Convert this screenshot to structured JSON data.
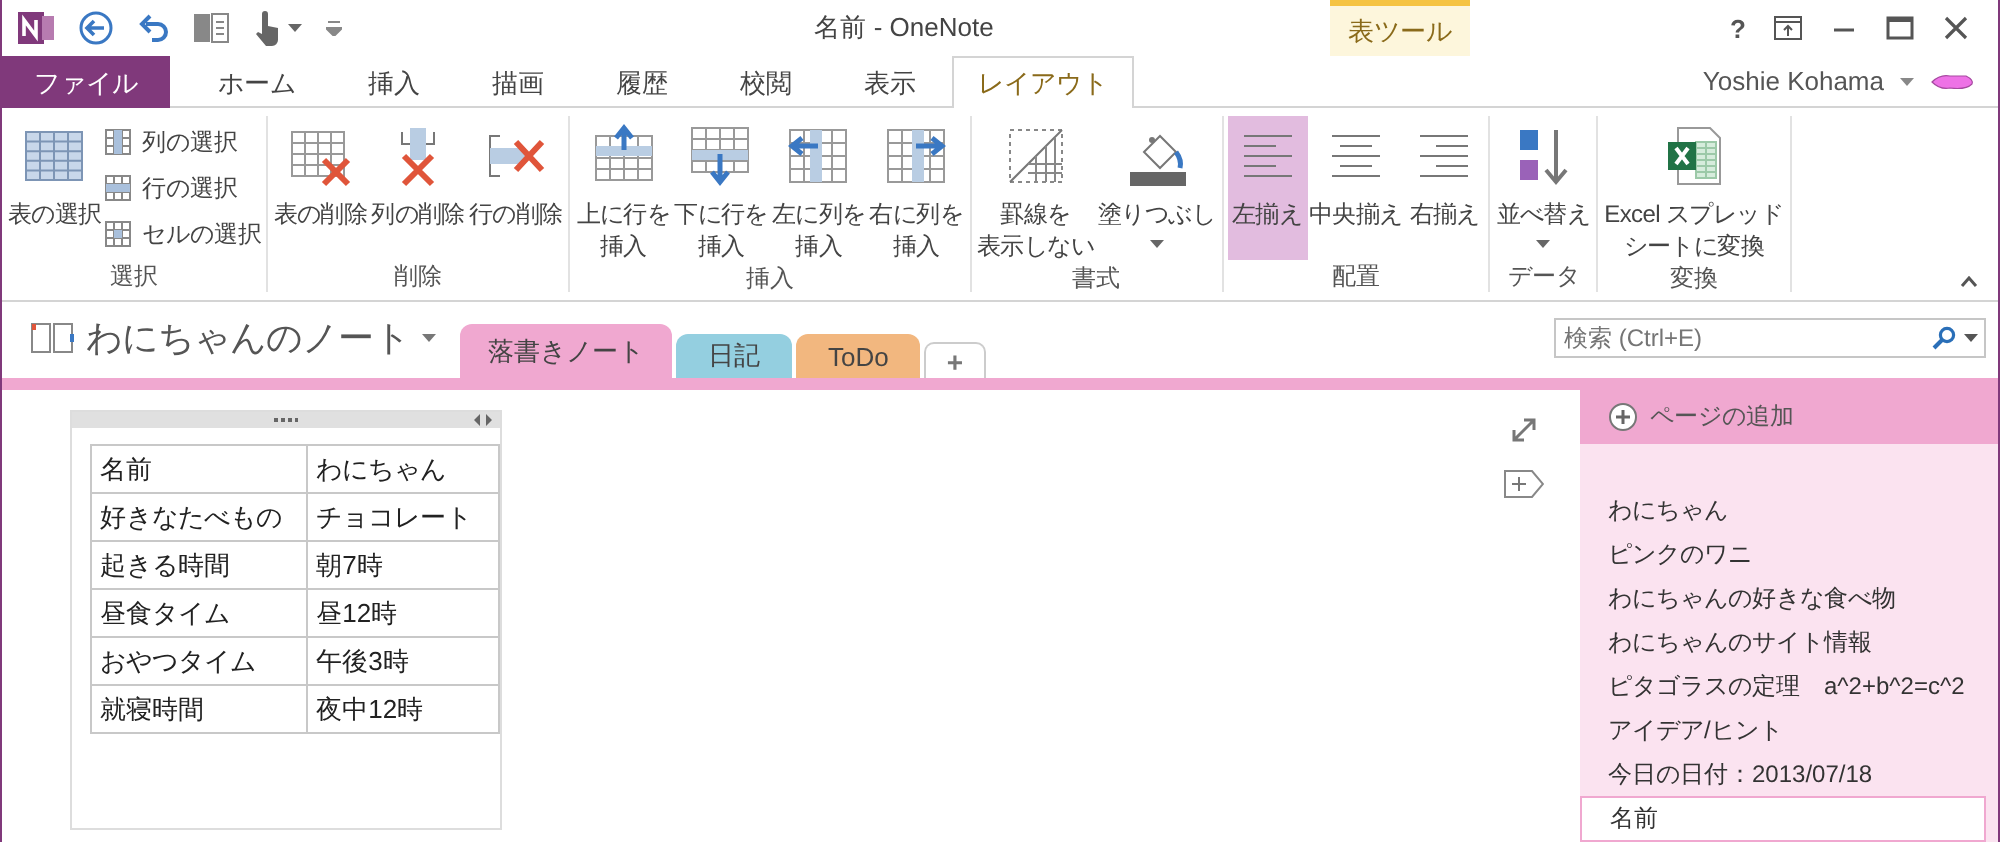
{
  "window": {
    "title": "名前 - OneNote",
    "context_tab": "表ツール",
    "help": "?"
  },
  "ribbon_tabs": [
    {
      "label": "ファイル",
      "kind": "file",
      "selected": false
    },
    {
      "label": "ホーム",
      "kind": "normal",
      "selected": false
    },
    {
      "label": "挿入",
      "kind": "normal",
      "selected": false
    },
    {
      "label": "描画",
      "kind": "normal",
      "selected": false
    },
    {
      "label": "履歴",
      "kind": "normal",
      "selected": false
    },
    {
      "label": "校閲",
      "kind": "normal",
      "selected": false
    },
    {
      "label": "表示",
      "kind": "normal",
      "selected": false
    },
    {
      "label": "レイアウト",
      "kind": "context",
      "selected": true
    }
  ],
  "user": "Yoshie Kohama",
  "ribbon_groups": [
    {
      "label": "選択",
      "commands": [
        {
          "kind": "large",
          "label": "表の選択",
          "dropdown": false
        },
        {
          "kind": "small",
          "label": "列の選択"
        },
        {
          "kind": "small",
          "label": "行の選択"
        },
        {
          "kind": "small",
          "label": "セルの選択"
        }
      ]
    },
    {
      "label": "削除",
      "commands": [
        {
          "kind": "large",
          "label": "表の削除",
          "dropdown": false
        },
        {
          "kind": "large",
          "label": "列の削除",
          "dropdown": false
        },
        {
          "kind": "large",
          "label": "行の削除",
          "dropdown": false
        }
      ]
    },
    {
      "label": "挿入",
      "commands": [
        {
          "kind": "large",
          "label": "上に行を挿入",
          "dropdown": false
        },
        {
          "kind": "large",
          "label": "下に行を挿入",
          "dropdown": false
        },
        {
          "kind": "large",
          "label": "左に列を挿入",
          "dropdown": false
        },
        {
          "kind": "large",
          "label": "右に列を挿入",
          "dropdown": false
        }
      ]
    },
    {
      "label": "書式",
      "commands": [
        {
          "kind": "large",
          "label": "罫線を表示しない",
          "dropdown": false
        },
        {
          "kind": "large",
          "label": "塗りつぶし",
          "dropdown": true
        }
      ]
    },
    {
      "label": "配置",
      "commands": [
        {
          "kind": "large",
          "label": "左揃え",
          "dropdown": false,
          "selected": true
        },
        {
          "kind": "large",
          "label": "中央揃え",
          "dropdown": false,
          "selected": false
        },
        {
          "kind": "large",
          "label": "右揃え",
          "dropdown": false,
          "selected": false
        }
      ]
    },
    {
      "label": "データ",
      "commands": [
        {
          "kind": "large",
          "label": "並べ替え",
          "dropdown": true
        }
      ]
    },
    {
      "label": "変換",
      "commands": [
        {
          "kind": "large",
          "label": "Excel スプレッドシートに変換",
          "dropdown": false
        }
      ]
    }
  ],
  "notebook": {
    "name": "わにちゃんのノート"
  },
  "sections": [
    {
      "label": "落書きノート",
      "color": "#f0a8d0",
      "selected": true
    },
    {
      "label": "日記",
      "color": "#94cfe0",
      "selected": false
    },
    {
      "label": "ToDo",
      "color": "#f2b77f",
      "selected": false
    }
  ],
  "add_section": "+",
  "search": {
    "placeholder": "検索 (Ctrl+E)"
  },
  "table": {
    "rows": [
      [
        "名前",
        "わにちゃん"
      ],
      [
        "好きなたべもの",
        "チョコレート"
      ],
      [
        "起きる時間",
        "朝7時"
      ],
      [
        "昼食タイム",
        "昼12時"
      ],
      [
        "おやつタイム",
        "午後3時"
      ],
      [
        "就寝時間",
        "夜中12時"
      ]
    ]
  },
  "add_page": "ページの追加",
  "pages": [
    {
      "title": "わにちゃん",
      "selected": false
    },
    {
      "title": "ピンクのワニ",
      "selected": false
    },
    {
      "title": "わにちゃんの好きな食べ物",
      "selected": false
    },
    {
      "title": "わにちゃんのサイト情報",
      "selected": false
    },
    {
      "title": "ピタゴラスの定理　a^2+b^2=c^2",
      "selected": false
    },
    {
      "title": "アイデア/ヒント",
      "selected": false
    },
    {
      "title": "今日の日付：2013/07/18",
      "selected": false
    },
    {
      "title": "名前",
      "selected": true
    }
  ]
}
